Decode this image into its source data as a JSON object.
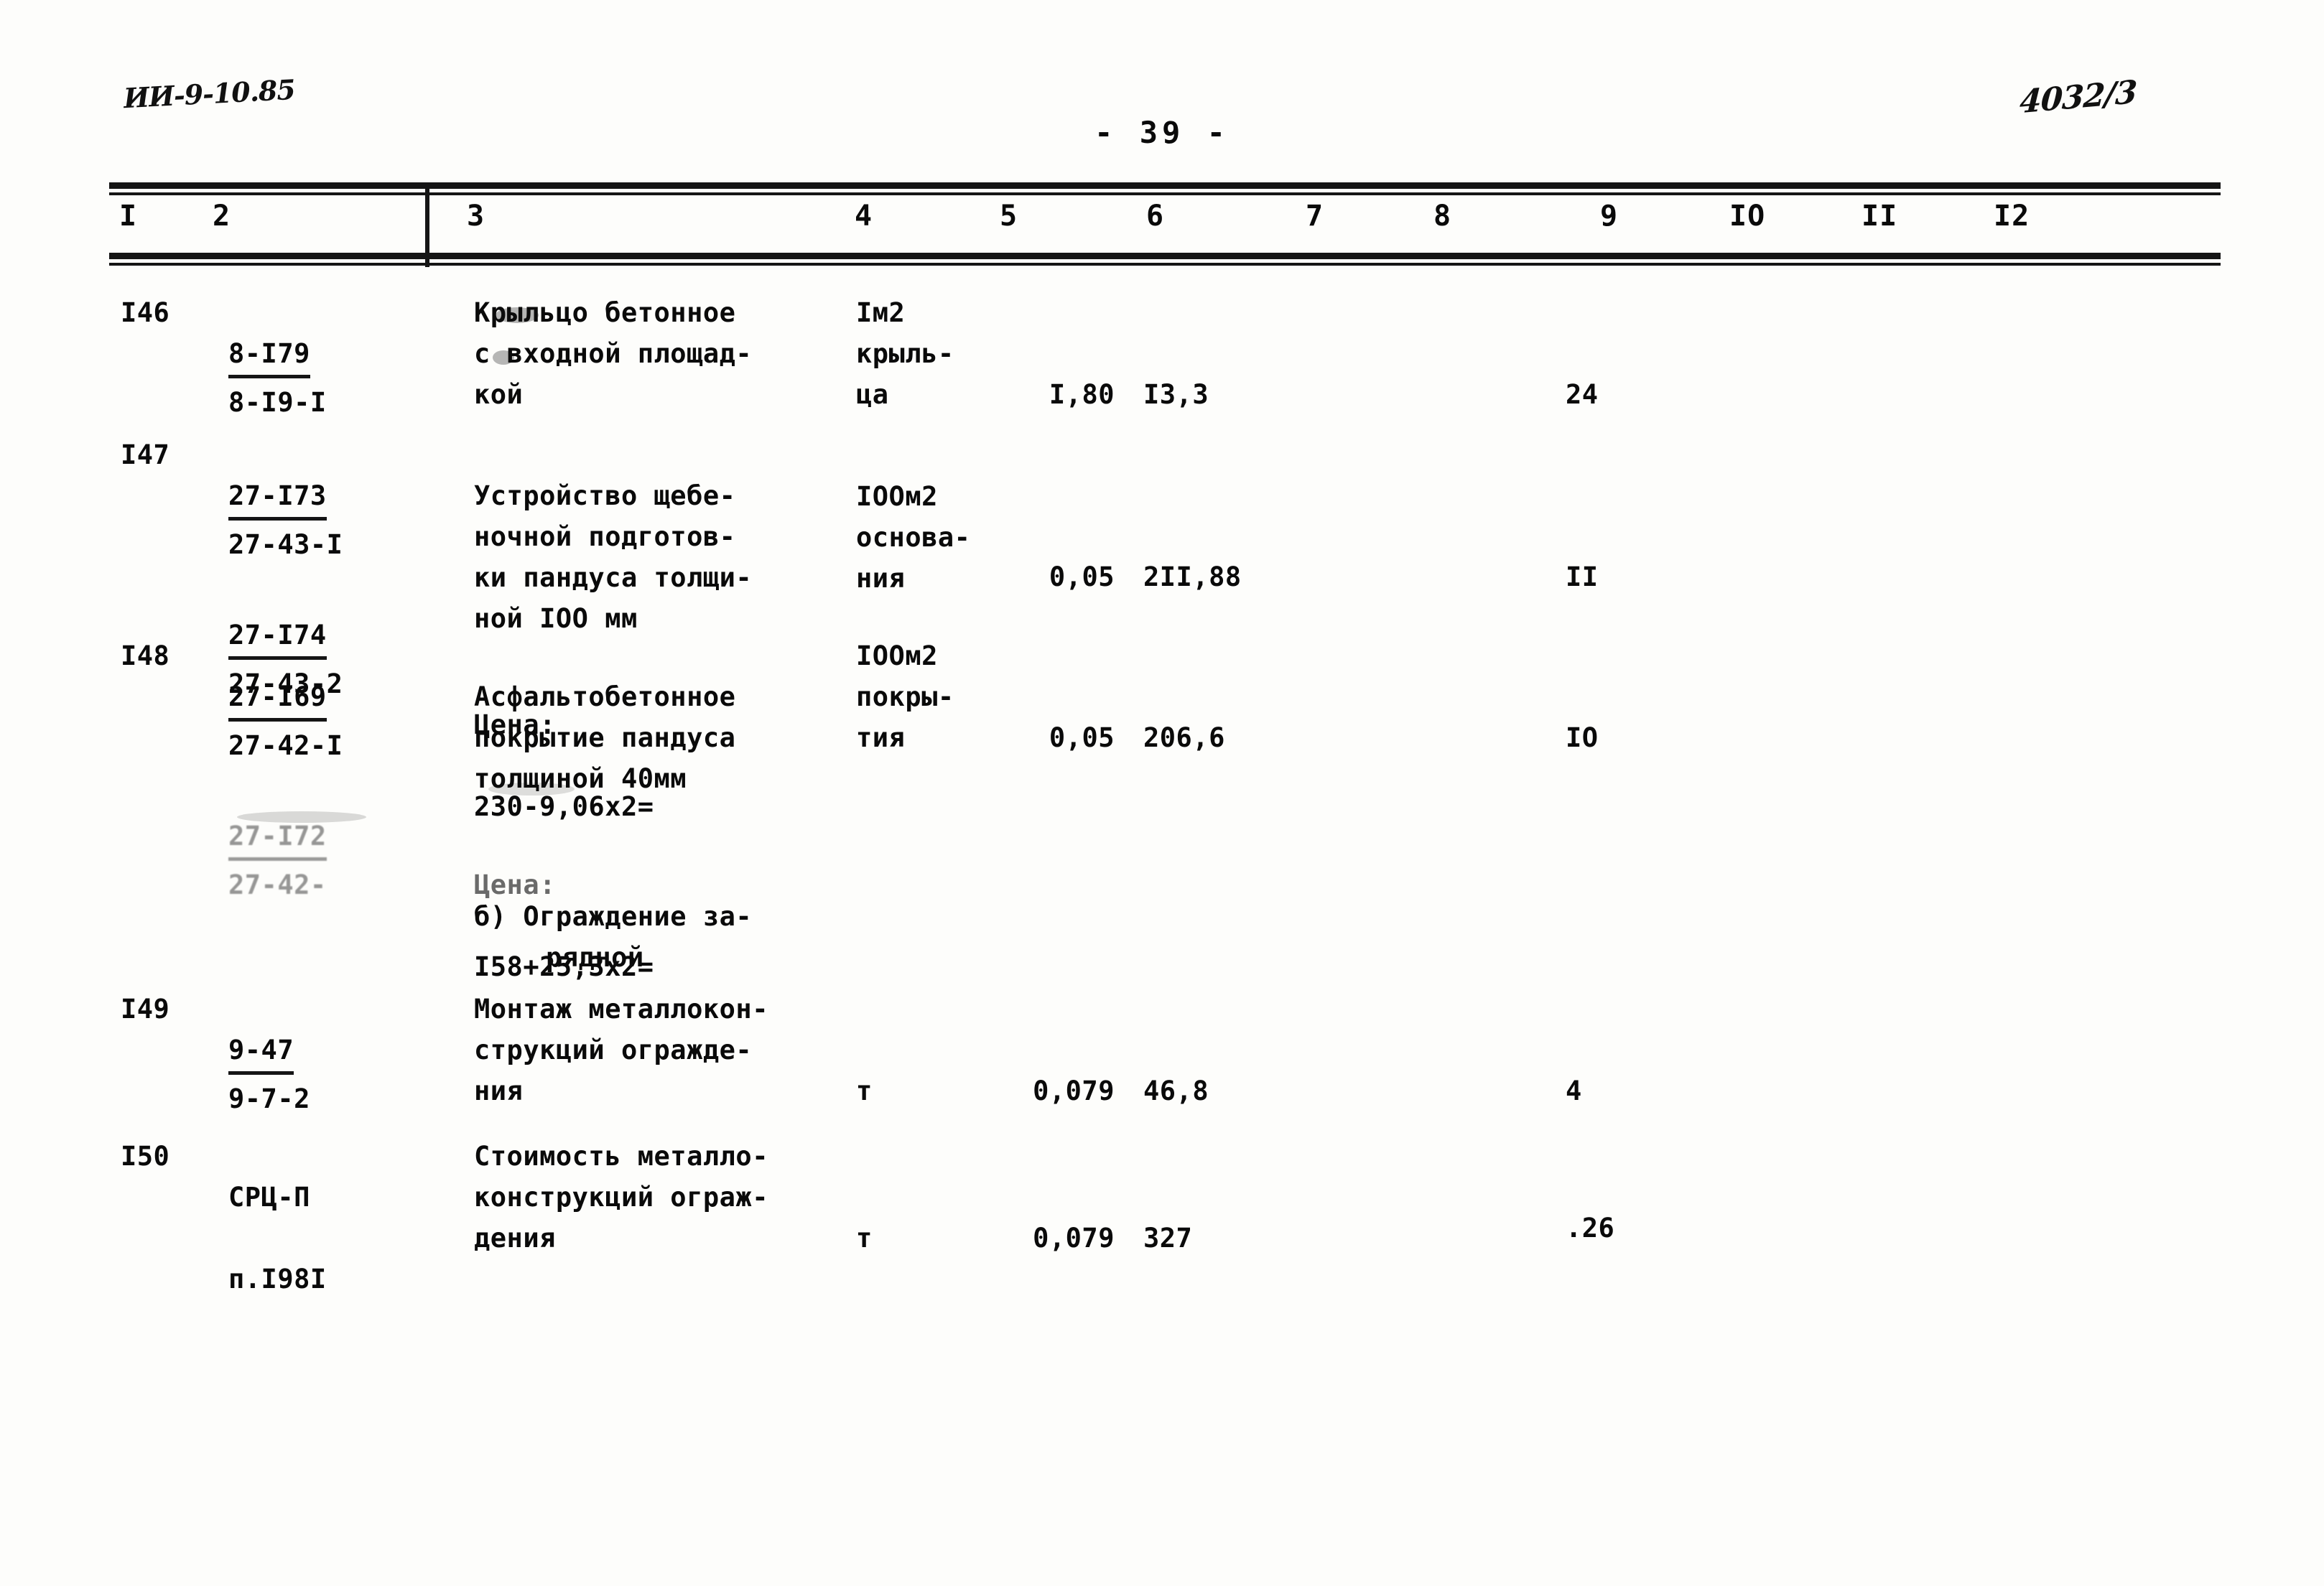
{
  "document": {
    "page_number": "- 39 -",
    "margin_note_left": "ИИ-9-10.85",
    "margin_note_right": "4032/3"
  },
  "table": {
    "column_headers": [
      "I",
      "2",
      "3",
      "4",
      "5",
      "6",
      "7",
      "8",
      "9",
      "IO",
      "II",
      "I2"
    ],
    "rows": [
      {
        "num": "I46",
        "code_top": "8-I79",
        "code_bottom": "8-I9-I",
        "description": "Крыльцо бетонное\nс входной площад-\nкой",
        "unit": "Iм2\nкрыль-\nца",
        "qty": "I,80",
        "price": "I3,3",
        "col7": "",
        "col8": "",
        "col9": "24",
        "col10": "",
        "col11": "",
        "col12": ""
      },
      {
        "num": "I47",
        "code_top": "27-I73",
        "code_bottom": "27-43-I",
        "code_top2": "27-I74",
        "code_bottom2": "27-43-2",
        "description": "Устройство щебе-\nночной подготов-\nки пандуса толщи-\nной IOO мм",
        "price_label": "Цена:",
        "price_formula": "230-9,06x2=",
        "unit": "IOOм2\nоснова-\nния",
        "qty": "0,05",
        "price": "2II,88",
        "col7": "",
        "col8": "",
        "col9": "II",
        "col10": "",
        "col11": "",
        "col12": ""
      },
      {
        "num": "I48",
        "code_top": "27-I69",
        "code_bottom": "27-42-I",
        "code_top2": "27-I72",
        "code_bottom2": "27-42-",
        "description": "Асфальтобетонное\nпокрытие пандуса\nтолщиной 40мм",
        "price_label": "Цена:",
        "price_formula": "I58+25,3x2=",
        "unit": "IOOм2\nпокры-\nтия",
        "qty": "0,05",
        "price": "206,6",
        "col7": "",
        "col8": "",
        "col9": "IO",
        "col10": "",
        "col11": "",
        "col12": ""
      },
      {
        "num": "I49",
        "code_top": "9-47",
        "code_bottom": "9-7-2",
        "description": "Монтаж металлокон-\nструкций огражде-\nния",
        "unit": "т",
        "qty": "0,079",
        "price": "46,8",
        "col7": "",
        "col8": "",
        "col9": "4",
        "col10": "",
        "col11": "",
        "col12": ""
      },
      {
        "num": "I50",
        "code_top": "СРЦ-П",
        "code_bottom": "п.I98I",
        "description": "Стоимость металло-\nконструкций ограж-\nдения",
        "unit": "т",
        "qty": "0,079",
        "price": "327",
        "col7": "",
        "col8": "",
        "col9": ".26",
        "col10": "",
        "col11": "",
        "col12": ""
      }
    ],
    "section_heading": {
      "line1": "б) Ограждение за-",
      "line2": "рядной"
    }
  }
}
